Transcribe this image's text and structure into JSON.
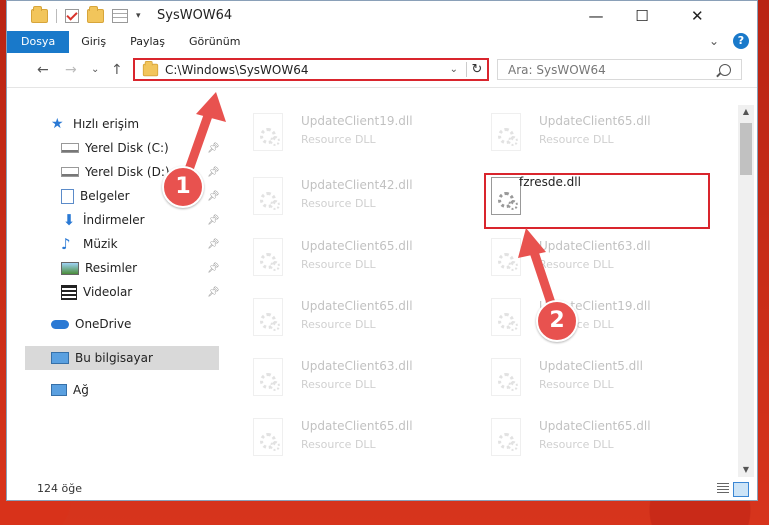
{
  "window": {
    "title": "SysWOW64",
    "controls": {
      "minimize": "—",
      "maximize": "☐",
      "close": "✕"
    }
  },
  "ribbon": {
    "tabs": [
      "Dosya",
      "Giriş",
      "Paylaş",
      "Görünüm"
    ],
    "expand": "⌄",
    "help": "?"
  },
  "nav": {
    "back": "←",
    "forward": "→",
    "recent": "⌄",
    "up": "↑",
    "address": "C:\\Windows\\SysWOW64",
    "search_placeholder": "Ara: SysWOW64"
  },
  "sidebar": {
    "items": [
      {
        "label": "Hızlı erişim",
        "icon": "star-icon"
      },
      {
        "label": "Yerel Disk (C:)",
        "icon": "drive-icon",
        "pinned": true
      },
      {
        "label": "Yerel Disk (D:)",
        "icon": "drive-icon",
        "pinned": true
      },
      {
        "label": "Belgeler",
        "icon": "documents-icon",
        "pinned": true
      },
      {
        "label": "İndirmeler",
        "icon": "downloads-icon",
        "pinned": true
      },
      {
        "label": "Müzik",
        "icon": "music-icon",
        "pinned": true
      },
      {
        "label": "Resimler",
        "icon": "pictures-icon",
        "pinned": true
      },
      {
        "label": "Videolar",
        "icon": "videos-icon",
        "pinned": true
      },
      {
        "label": "OneDrive",
        "icon": "onedrive-icon"
      },
      {
        "label": "Bu bilgisayar",
        "icon": "computer-icon",
        "selected": true
      },
      {
        "label": "Ağ",
        "icon": "network-icon"
      }
    ]
  },
  "files": [
    {
      "name": "UpdateClient19.dll",
      "type": "Resource DLL"
    },
    {
      "name": "UpdateClient65.dll",
      "type": "Resource DLL"
    },
    {
      "name": "UpdateClient42.dll",
      "type": "Resource DLL"
    },
    {
      "name": "fzresde.dll",
      "type": ""
    },
    {
      "name": "UpdateClient65.dll",
      "type": "Resource DLL"
    },
    {
      "name": "UpdateClient63.dll",
      "type": "Resource DLL"
    },
    {
      "name": "UpdateClient65.dll",
      "type": "Resource DLL"
    },
    {
      "name": "UpdateClient19.dll",
      "type": "Resource DLL"
    },
    {
      "name": "UpdateClient63.dll",
      "type": "Resource DLL"
    },
    {
      "name": "UpdateClient5.dll",
      "type": "Resource DLL"
    },
    {
      "name": "UpdateClient65.dll",
      "type": "Resource DLL"
    },
    {
      "name": "UpdateClient65.dll",
      "type": "Resource DLL"
    }
  ],
  "status": {
    "count": "124 öğe"
  },
  "annotations": {
    "badge1": "1",
    "badge2": "2",
    "color": "#e8524f",
    "highlight_color": "#d9252d"
  }
}
